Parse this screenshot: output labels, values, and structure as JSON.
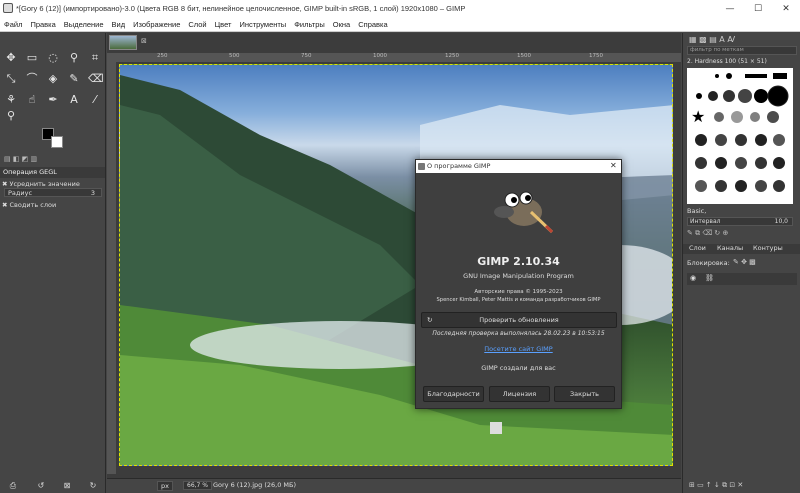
{
  "window": {
    "title": "*[Gory 6 (12)] (импортировано)-3.0 (Цвета RGB 8 бит, нелинейное целочисленное, GIMP built-in sRGB, 1 слой) 1920x1080 – GIMP",
    "minimize": "—",
    "maximize": "☐",
    "close": "✕"
  },
  "menu": [
    "Файл",
    "Правка",
    "Выделение",
    "Вид",
    "Изображение",
    "Слой",
    "Цвет",
    "Инструменты",
    "Фильтры",
    "Окна",
    "Справка"
  ],
  "toolOptions": {
    "title": "Операция GEGL",
    "item1": "Усреднить значение",
    "radius_label": "Радиус",
    "radius_value": "3",
    "item2": "Сводить слои"
  },
  "rightDock": {
    "filter_placeholder": "фильтр по меткам",
    "brush_name": "2. Hardness 100 (51 × 51)",
    "preset": "Basic,",
    "interval_label": "Интервал",
    "interval_value": "10,0",
    "tabs": [
      "Слои",
      "Каналы",
      "Контуры"
    ],
    "lock_label": "Блокировка:"
  },
  "status": {
    "unit": "px",
    "zoom": "66,7 %",
    "filename": "Gory 6 (12).jpg (26,0 МБ)"
  },
  "ruler": {
    "ticks": [
      "250",
      "500",
      "750",
      "1000",
      "1250",
      "1500",
      "1750"
    ]
  },
  "about": {
    "title": "О программе GIMP",
    "version": "GIMP 2.10.34",
    "subtitle": "GNU Image Manipulation Program",
    "copyright": "Авторские права © 1995-2023",
    "authors": "Spencer Kimball, Peter Mattis и команда разработчиков GIMP",
    "check_updates": "Проверить обновления",
    "last_check": "Последняя проверка выполнялась 28.02.23 в 10:53:15",
    "site_link": "Посетите сайт GIMP",
    "made_for": "GIMP создали для вас",
    "btn_credits": "Благодарности",
    "btn_license": "Лицензия",
    "btn_close": "Закрыть"
  },
  "colors": {
    "canvas_bg": "#3c3c3c",
    "panel_bg": "#454545",
    "dialog_bg": "#3f3f3f",
    "link": "#5aa0ff"
  }
}
